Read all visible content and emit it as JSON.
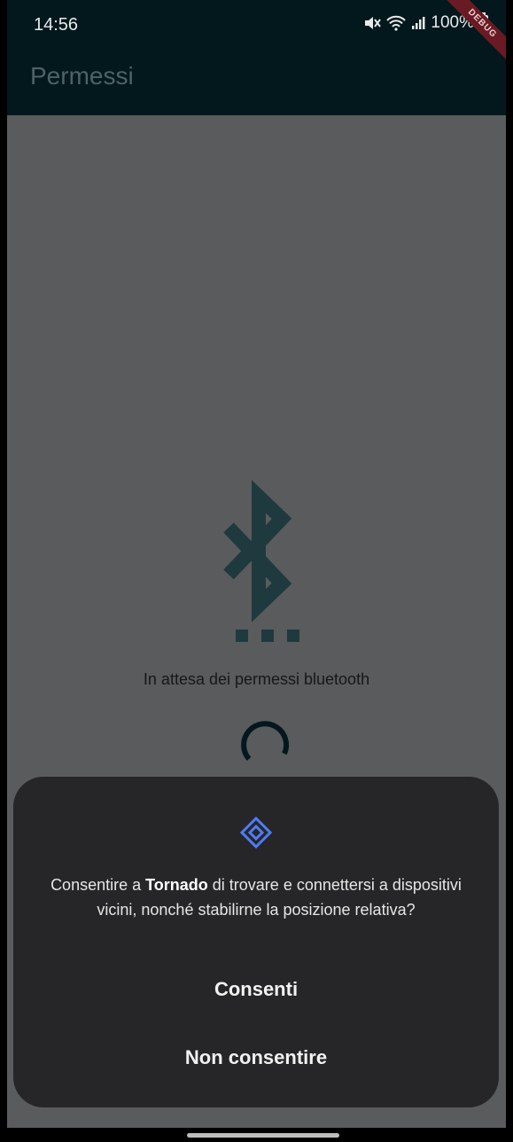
{
  "status_bar": {
    "time": "14:56",
    "battery": "100%"
  },
  "debug_banner": "DEBUG",
  "appbar": {
    "title": "Permessi"
  },
  "content": {
    "waiting_text": "In attesa dei permessi bluetooth"
  },
  "dialog": {
    "message_prefix": "Consentire a ",
    "app_name": "Tornado",
    "message_suffix": " di trovare e connettersi a dispositivi vicini, nonché stabilirne la posizione relativa?",
    "allow_label": "Consenti",
    "deny_label": "Non consentire"
  },
  "icons": {
    "bluetooth": "bluetooth-searching-icon",
    "nearby": "nearby-devices-icon",
    "spinner": "loading-spinner"
  },
  "colors": {
    "appbar": "#02181d",
    "scrim": "#5a5b5c",
    "icon": "#1f3a3f",
    "dialog": "#262628",
    "accent": "#4f7cf5"
  }
}
